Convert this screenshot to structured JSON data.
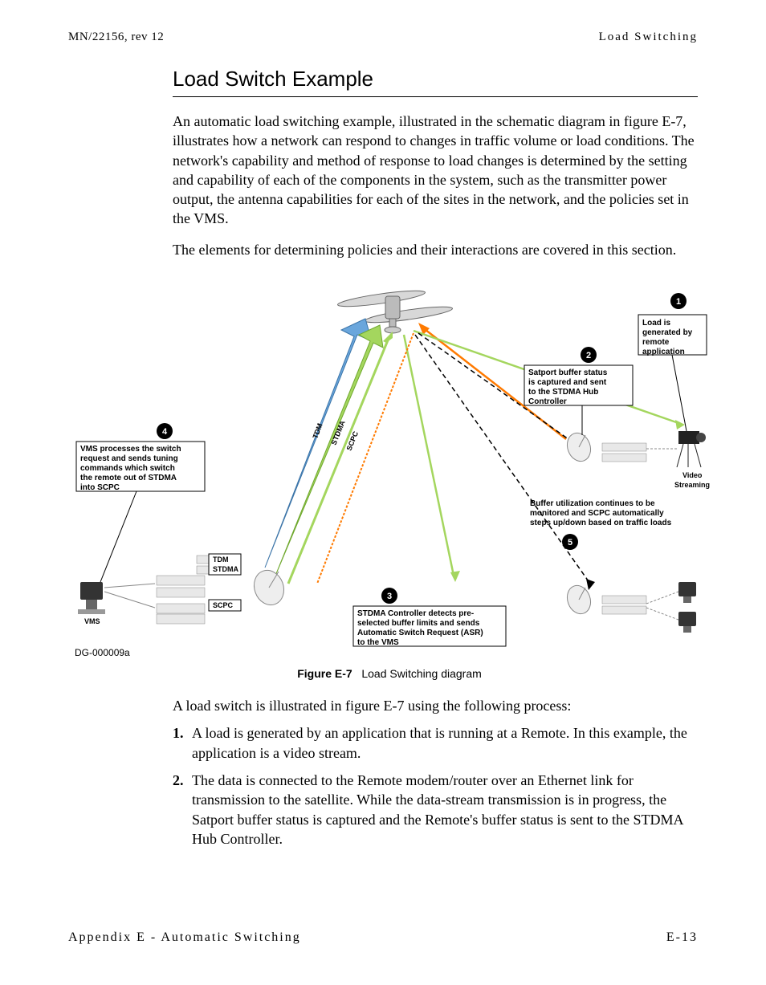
{
  "header": {
    "left": "MN/22156, rev 12",
    "right": "Load Switching"
  },
  "section_title": "Load Switch Example",
  "para1": "An automatic load switching example, illustrated in the schematic diagram in figure E-7, illustrates how a network can respond to changes in traffic volume or load conditions. The network's capability and method of response to load changes is determined by the setting and capability of each of the components in the system, such as the transmitter power output, the antenna capabilities for each of the sites in the network, and the policies set in the VMS.",
  "para2": "The elements for determining policies and their interactions are covered in this section.",
  "figure": {
    "caption_label": "Figure E-7",
    "caption_text": "Load Switching diagram",
    "dg_label": "DG-000009a",
    "callout1": [
      "Load is",
      "generated by",
      "remote",
      "application"
    ],
    "callout2": [
      "Satport buffer status",
      "is captured and sent",
      "to the STDMA Hub",
      "Controller"
    ],
    "callout3": [
      "STDMA Controller detects pre-",
      "selected buffer limits and sends",
      "Automatic Switch Request (ASR)",
      "to the VMS"
    ],
    "callout4": [
      "VMS processes the switch",
      "request and sends tuning",
      "commands which switch",
      "the remote out of STDMA",
      "into SCPC"
    ],
    "callout5": [
      "Buffer utilization continues to be",
      "monitored and SCPC automatically",
      "steps up/down based on traffic loads"
    ],
    "labels": {
      "tdm": "TDM",
      "stdma": "STDMA",
      "scpc": "SCPC",
      "vms": "VMS",
      "video": "Video",
      "streaming": "Streaming"
    },
    "badges": {
      "b1": "1",
      "b2": "2",
      "b3": "3",
      "b4": "4",
      "b5": "5"
    }
  },
  "list_intro": "A load switch is illustrated in figure E-7 using the following process:",
  "items": [
    {
      "num": "1.",
      "text": "A load is generated by an application that is running at a Remote. In this example, the application is a video stream."
    },
    {
      "num": "2.",
      "text": "The data is connected to the Remote modem/router over an Ethernet link for transmission to the satellite. While the data-stream transmission is in progress, the Satport buffer status is captured and the Remote's buffer status is sent to the STDMA Hub Controller."
    }
  ],
  "footer": {
    "left": "Appendix E - Automatic Switching",
    "right": "E-13"
  }
}
